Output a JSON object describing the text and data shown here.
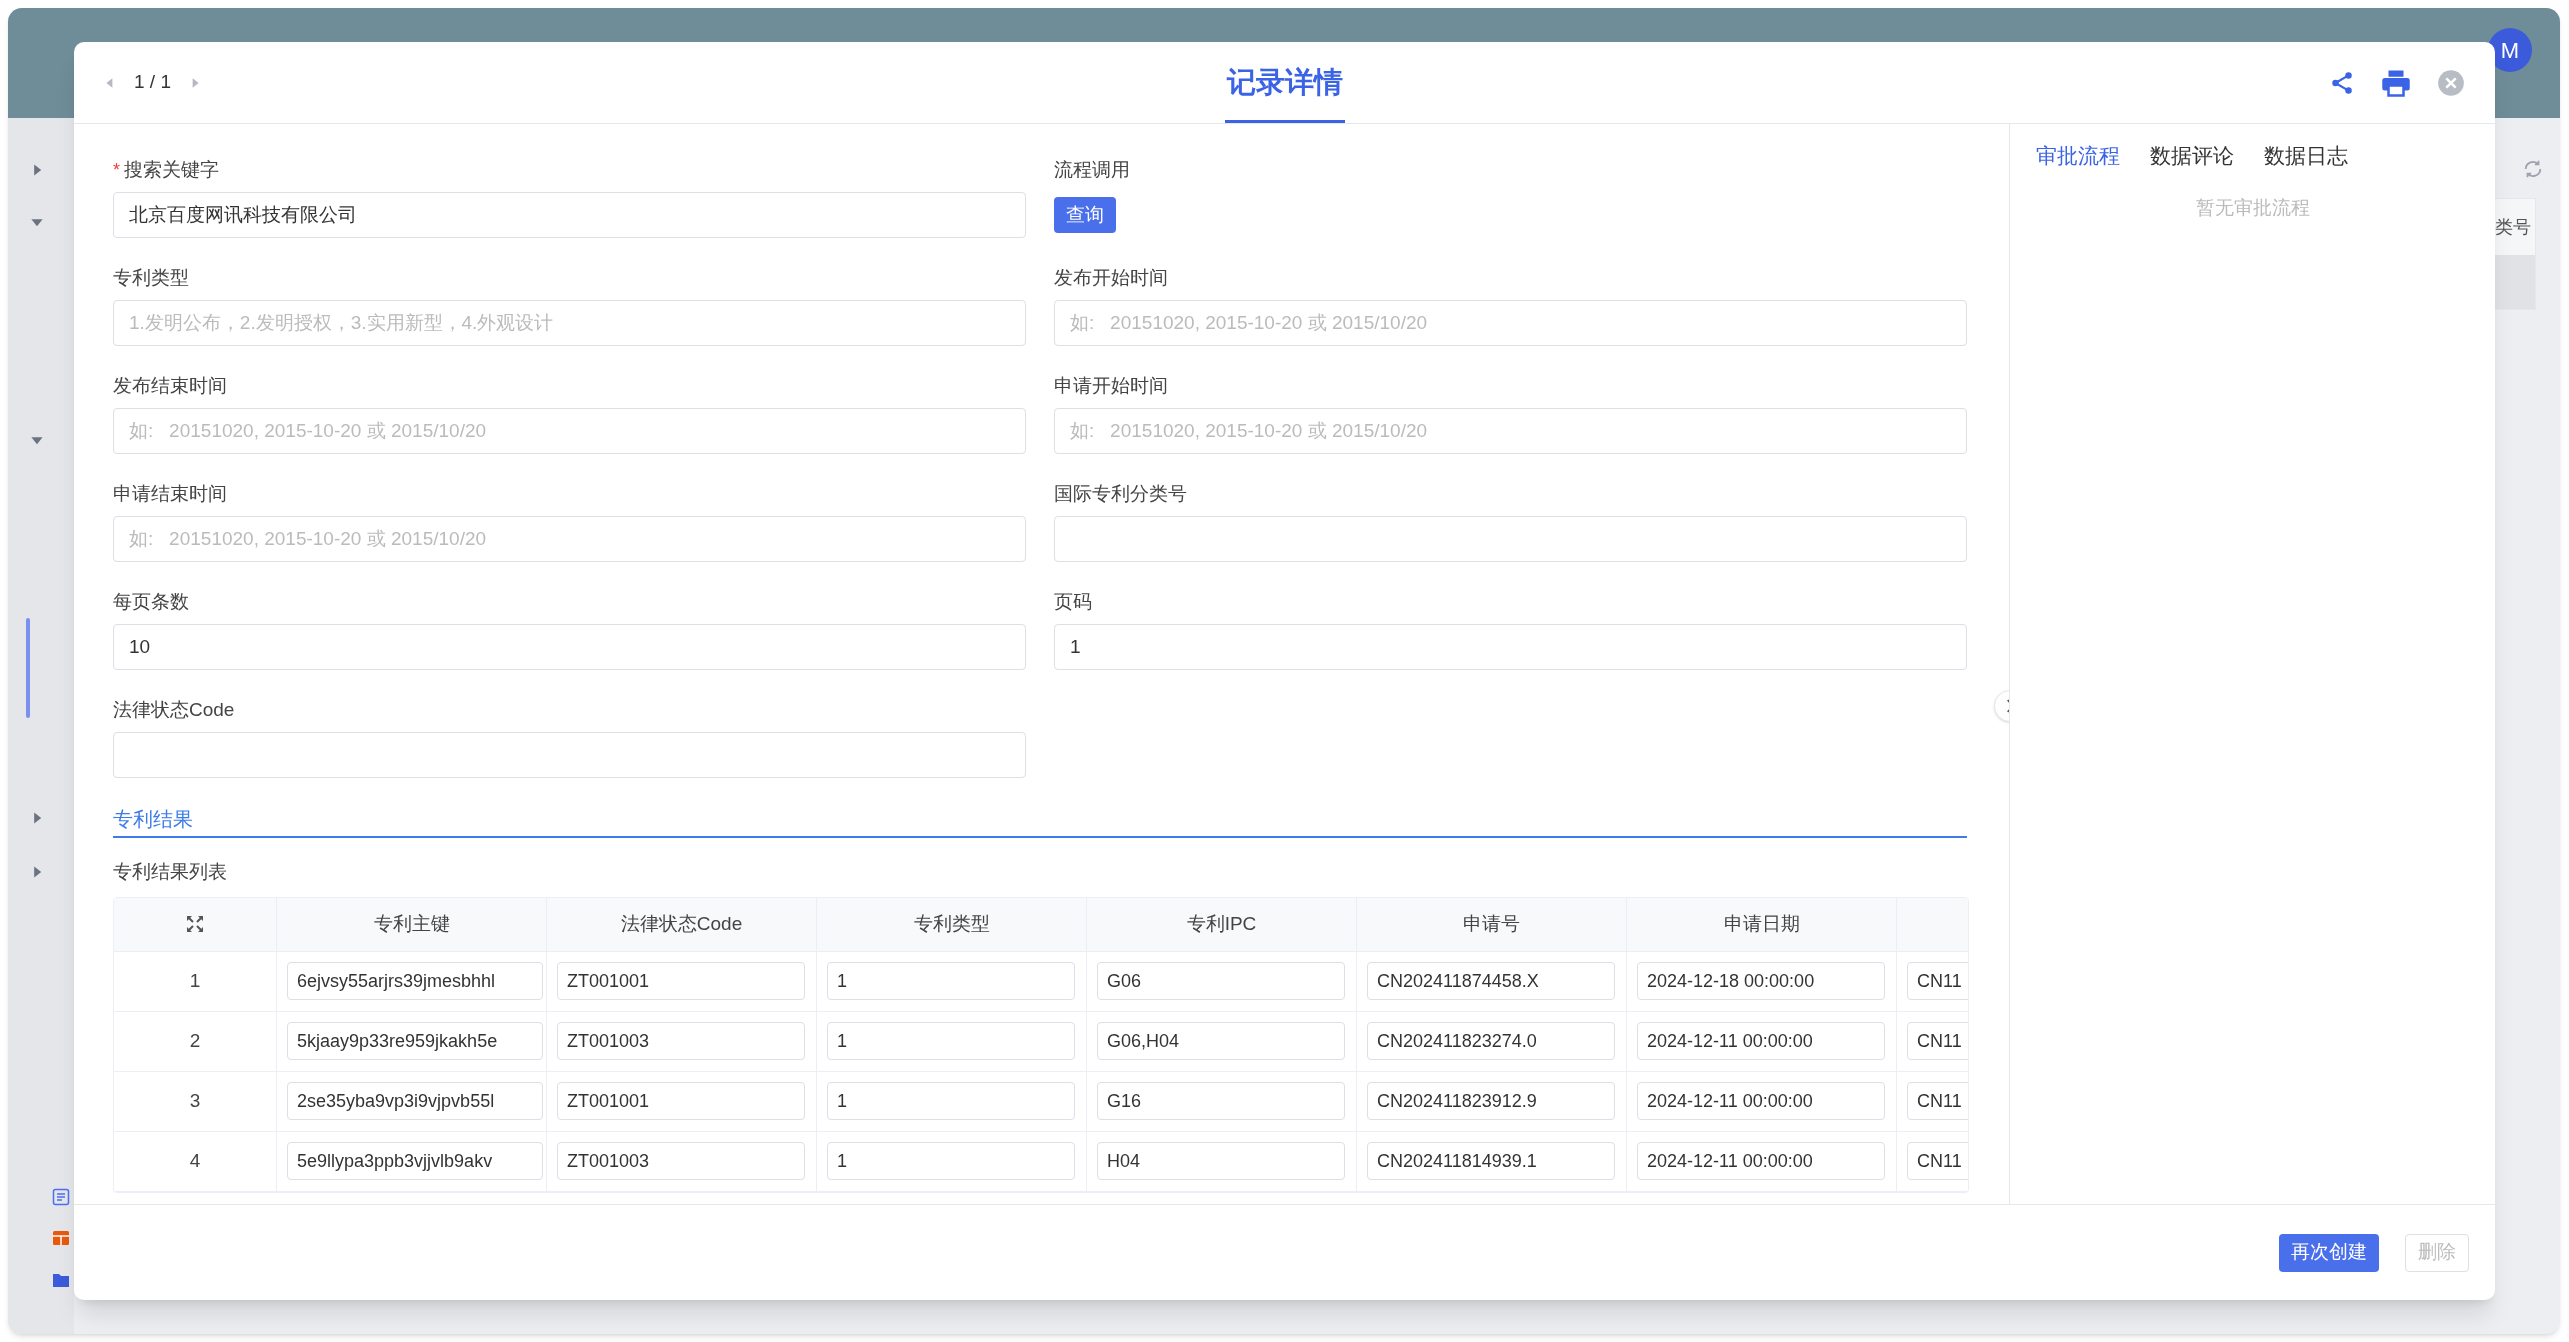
{
  "app": {
    "avatar": "M",
    "background_column": "类号"
  },
  "sidebar": {
    "items": [
      {
        "expanded": false
      },
      {
        "expanded": true
      },
      {
        "expanded": true
      },
      {
        "expanded": false
      },
      {
        "expanded": false
      }
    ]
  },
  "modal": {
    "pager": "1 / 1",
    "title": "记录详情",
    "form": {
      "fields": [
        {
          "kind": "input",
          "label": "搜索关键字",
          "required_mark": "*",
          "value": "北京百度网讯科技有限公司"
        },
        {
          "kind": "button",
          "label": "流程调用",
          "button": "查询"
        },
        {
          "kind": "input",
          "label": "专利类型",
          "placeholder": "1.发明公布，2.发明授权，3.实用新型，4.外观设计"
        },
        {
          "kind": "input",
          "label": "发布开始时间",
          "placeholder": "如:   20151020, 2015-10-20 或 2015/10/20"
        },
        {
          "kind": "input",
          "label": "发布结束时间",
          "placeholder": "如:   20151020, 2015-10-20 或 2015/10/20"
        },
        {
          "kind": "input",
          "label": "申请开始时间",
          "placeholder": "如:   20151020, 2015-10-20 或 2015/10/20"
        },
        {
          "kind": "input",
          "label": "申请结束时间",
          "placeholder": "如:   20151020, 2015-10-20 或 2015/10/20"
        },
        {
          "kind": "input",
          "label": "国际专利分类号"
        },
        {
          "kind": "input",
          "label": "每页条数",
          "value": "10"
        },
        {
          "kind": "input",
          "label": "页码",
          "value": "1"
        },
        {
          "kind": "input",
          "label": "法律状态Code"
        }
      ]
    },
    "section": "专利结果",
    "table": {
      "title": "专利结果列表",
      "columns": [
        "专利主键",
        "法律状态Code",
        "专利类型",
        "专利IPC",
        "申请号",
        "申请日期"
      ],
      "rows": [
        {
          "index": "1",
          "cells": [
            "6ejvsy55arjrs39jmesbhhl",
            "ZT001001",
            "1",
            "G06",
            "CN202411874458.X",
            "2024-12-18 00:00:00",
            "CN11"
          ]
        },
        {
          "index": "2",
          "cells": [
            "5kjaay9p33re959jkakh5e",
            "ZT001003",
            "1",
            "G06,H04",
            "CN202411823274.0",
            "2024-12-11 00:00:00",
            "CN11"
          ]
        },
        {
          "index": "3",
          "cells": [
            "2se35yba9vp3i9vjpvb55l",
            "ZT001001",
            "1",
            "G16",
            "CN202411823912.9",
            "2024-12-11 00:00:00",
            "CN11"
          ]
        },
        {
          "index": "4",
          "cells": [
            "5e9llypa3ppb3vjjvlb9akv",
            "ZT001003",
            "1",
            "H04",
            "CN202411814939.1",
            "2024-12-11 00:00:00",
            "CN11"
          ]
        }
      ]
    },
    "side_panel": {
      "tabs": [
        {
          "label": "审批流程",
          "selected": true
        },
        {
          "label": "数据评论",
          "selected": false
        },
        {
          "label": "数据日志",
          "selected": false
        }
      ],
      "empty": "暂无审批流程"
    },
    "footer": {
      "buttons": [
        {
          "kind": "primary",
          "label": "再次创建",
          "disabled": false
        },
        {
          "kind": "default",
          "label": "删除",
          "disabled": true
        }
      ]
    }
  }
}
